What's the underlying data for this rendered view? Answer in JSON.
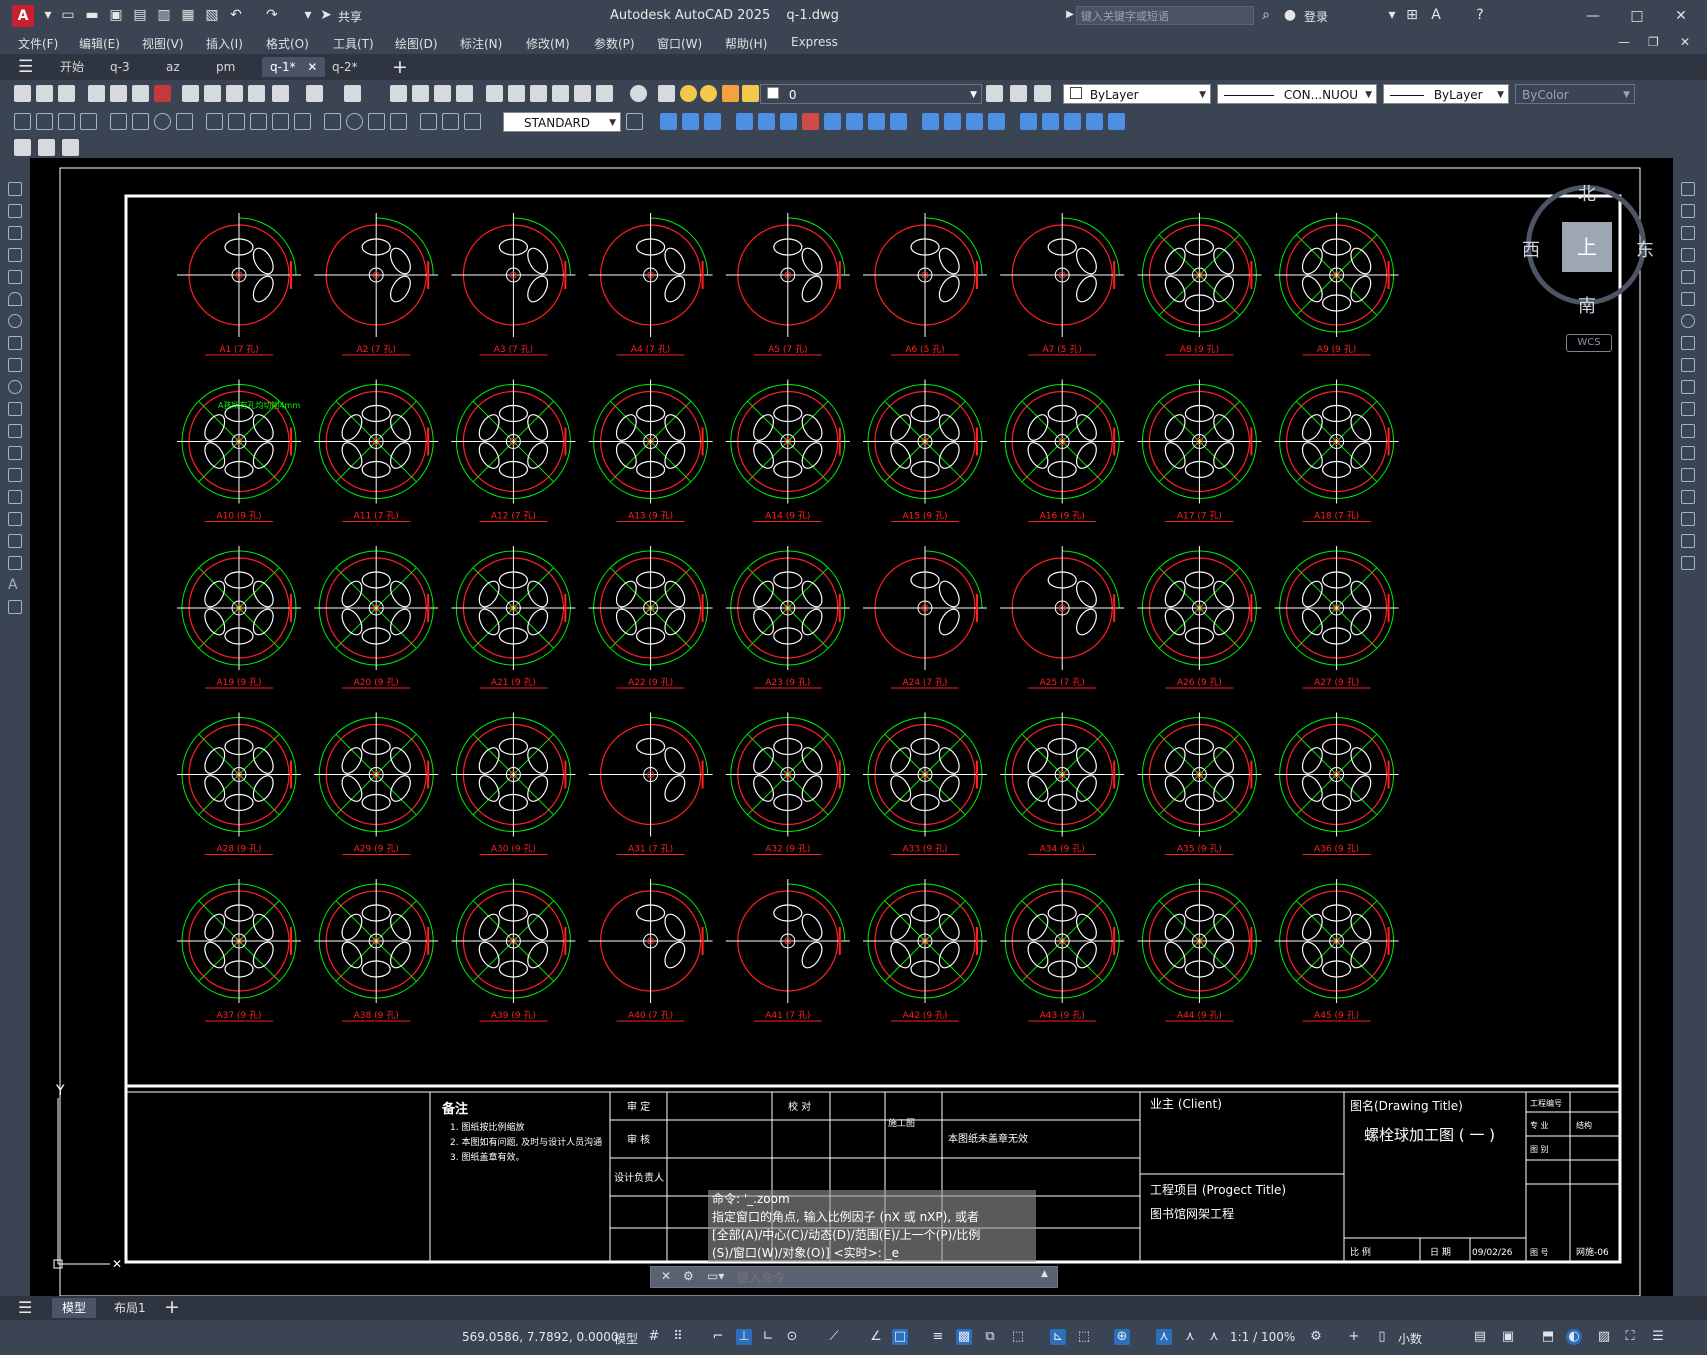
{
  "titlebar": {
    "app_logo": "A",
    "share_label": "共享",
    "title": "Autodesk AutoCAD 2025",
    "document": "q-1.dwg",
    "search_placeholder": "键入关键字或短语",
    "login_label": "登录"
  },
  "menu": [
    "文件(F)",
    "编辑(E)",
    "视图(V)",
    "插入(I)",
    "格式(O)",
    "工具(T)",
    "绘图(D)",
    "标注(N)",
    "修改(M)",
    "参数(P)",
    "窗口(W)",
    "帮助(H)",
    "Express"
  ],
  "tabs": [
    "开始",
    "q-3",
    "az",
    "pm",
    "q-1*",
    "q-2*"
  ],
  "toolbar": {
    "layer_value": "0",
    "color_value": "ByLayer",
    "linetype_value": "CON...NUOU",
    "lineweight_value": "ByLayer",
    "plotstyle_value": "ByColor",
    "dimstyle_value": "STANDARD"
  },
  "viewcube": {
    "north": "北",
    "south": "南",
    "east": "东",
    "west": "西",
    "top": "上",
    "wcs": "WCS"
  },
  "ucs": {
    "y_label": "Y"
  },
  "drawing": {
    "parts": [
      {
        "id": "A1",
        "qty": "7"
      },
      {
        "id": "A2",
        "qty": "7"
      },
      {
        "id": "A3",
        "qty": "7"
      },
      {
        "id": "A4",
        "qty": "7"
      },
      {
        "id": "A5",
        "qty": "7"
      },
      {
        "id": "A6",
        "qty": "5"
      },
      {
        "id": "A7",
        "qty": "5"
      },
      {
        "id": "A8",
        "qty": "9"
      },
      {
        "id": "A9",
        "qty": "9"
      },
      {
        "id": "A10",
        "qty": "9"
      },
      {
        "id": "A11",
        "qty": "7"
      },
      {
        "id": "A12",
        "qty": "7"
      },
      {
        "id": "A13",
        "qty": "9"
      },
      {
        "id": "A14",
        "qty": "9"
      },
      {
        "id": "A15",
        "qty": "9"
      },
      {
        "id": "A16",
        "qty": "9"
      },
      {
        "id": "A17",
        "qty": "7"
      },
      {
        "id": "A18",
        "qty": "7"
      },
      {
        "id": "A19",
        "qty": "9"
      },
      {
        "id": "A20",
        "qty": "9"
      },
      {
        "id": "A21",
        "qty": "9"
      },
      {
        "id": "A22",
        "qty": "9"
      },
      {
        "id": "A23",
        "qty": "9"
      },
      {
        "id": "A24",
        "qty": "7"
      },
      {
        "id": "A25",
        "qty": "7"
      },
      {
        "id": "A26",
        "qty": "9"
      },
      {
        "id": "A27",
        "qty": "9"
      },
      {
        "id": "A28",
        "qty": "9"
      },
      {
        "id": "A29",
        "qty": "9"
      },
      {
        "id": "A30",
        "qty": "9"
      },
      {
        "id": "A31",
        "qty": "7"
      },
      {
        "id": "A32",
        "qty": "9"
      },
      {
        "id": "A33",
        "qty": "9"
      },
      {
        "id": "A34",
        "qty": "9"
      },
      {
        "id": "A35",
        "qty": "9"
      },
      {
        "id": "A36",
        "qty": "9"
      },
      {
        "id": "A37",
        "qty": "9"
      },
      {
        "id": "A38",
        "qty": "9"
      },
      {
        "id": "A39",
        "qty": "9"
      },
      {
        "id": "A40",
        "qty": "7"
      },
      {
        "id": "A41",
        "qty": "7"
      },
      {
        "id": "A42",
        "qty": "9"
      },
      {
        "id": "A43",
        "qty": "9"
      },
      {
        "id": "A44",
        "qty": "9"
      },
      {
        "id": "A45",
        "qty": "9"
      }
    ],
    "note_a1": "A孩所有孔均切削4mm",
    "notes_title": "备注",
    "notes": [
      "1. 图纸按比例缩放",
      "2. 本图如有问题, 及时与设计人员沟通",
      "3. 图纸盖章有效。"
    ],
    "review_labels": [
      "审 定",
      "审 核",
      "设计负责人",
      "校 对"
    ],
    "construction_label": "施工图",
    "stamp_label": "本图纸未盖章无效",
    "client_label": "业主 (Client)",
    "project_label": "工程项目 (Progect Title)",
    "project_name": "图书馆网架工程",
    "drawing_title_label": "图名(Drawing Title)",
    "drawing_title": "螺栓球加工图 ( 一 )",
    "scale_label": "比 例",
    "date_label": "日 期",
    "date_value": "09/02/26",
    "project_no_label": "工程编号",
    "specialty_label": "专 业",
    "specialty_value": "结构",
    "sheet_label": "图 别",
    "sheet_no_label": "图 号",
    "sheet_no_value": "网施-06"
  },
  "command": {
    "history": [
      "命令: '_.zoom",
      "指定窗口的角点, 输入比例因子 (nX 或 nXP), 或者",
      "[全部(A)/中心(C)/动态(D)/范围(E)/上一个(P)/比例",
      "(S)/窗口(W)/对象(O)] <实时>: _e"
    ],
    "placeholder": "键入命令"
  },
  "layout_tabs": [
    "模型",
    "布局1"
  ],
  "status": {
    "coords": "569.0586, 7.7892, 0.0000",
    "model": "模型",
    "scale": "1:1 / 100%",
    "units": "小数"
  }
}
